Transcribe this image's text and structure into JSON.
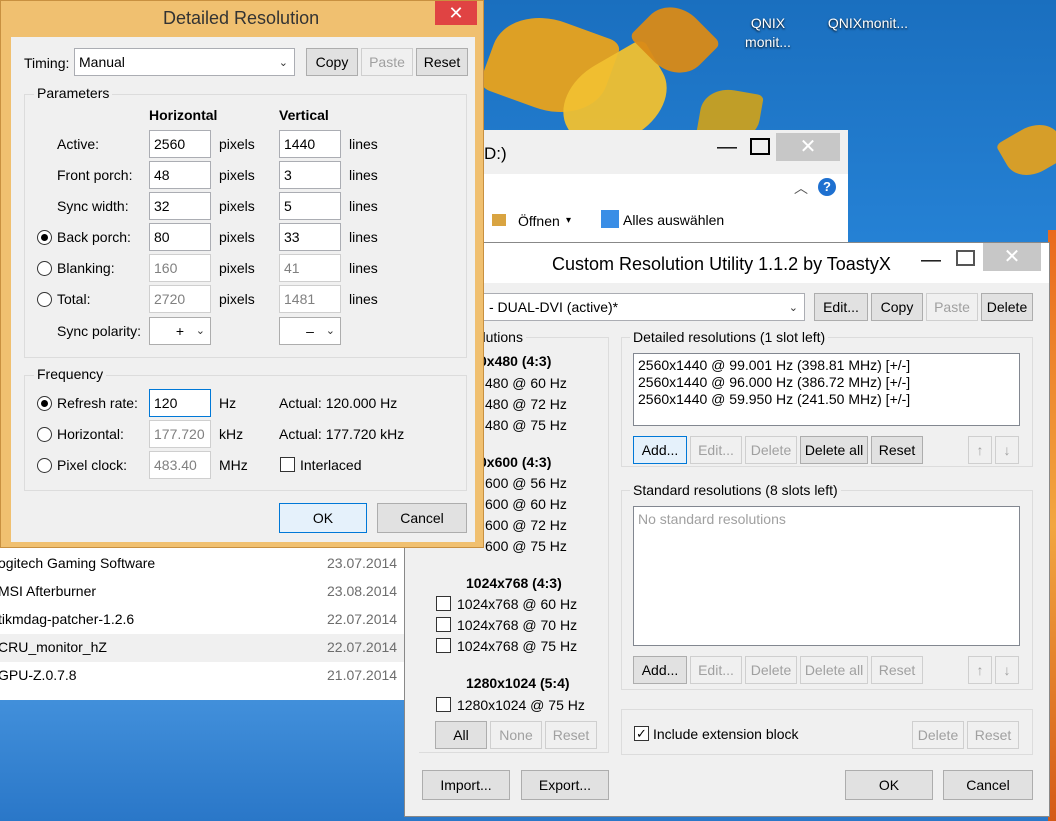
{
  "desktop": {
    "icons": [
      {
        "label": "QNIX\nmonit..."
      },
      {
        "label": "QNIXmonit..."
      }
    ]
  },
  "explorer": {
    "title_fragment": "D:)",
    "ribbon": {
      "open_label": "Öffnen",
      "select_all_label": "Alles auswählen"
    },
    "files": [
      {
        "name": "ogitech Gaming Software",
        "date": "23.07.2014"
      },
      {
        "name": "MSI Afterburner",
        "date": "23.08.2014"
      },
      {
        "name": "tikmdag-patcher-1.2.6",
        "date": "22.07.2014"
      },
      {
        "name": "CRU_monitor_hZ",
        "date": "22.07.2014"
      },
      {
        "name": "GPU-Z.0.7.8",
        "date": "21.07.2014"
      }
    ]
  },
  "cru": {
    "title": "Custom Resolution Utility 1.1.2 by ToastyX",
    "monitor_select": "- DUAL-DVI (active)*",
    "buttons": {
      "edit": "Edit...",
      "copy": "Copy",
      "paste": "Paste",
      "delete": "Delete"
    },
    "established": {
      "title_fragment": "ned resolutions",
      "groups": [
        {
          "header": "0x480 (4:3)",
          "items": [
            "480 @ 60 Hz",
            "480 @ 72 Hz",
            "480 @ 75 Hz"
          ]
        },
        {
          "header": "0x600 (4:3)",
          "items": [
            "600 @ 56 Hz",
            "600 @ 60 Hz",
            "600 @ 72 Hz",
            "600 @ 75 Hz"
          ]
        },
        {
          "header": "1024x768 (4:3)",
          "items": [
            "1024x768 @ 60 Hz",
            "1024x768 @ 70 Hz",
            "1024x768 @ 75 Hz"
          ]
        },
        {
          "header": "1280x1024 (5:4)",
          "items": [
            "1280x1024 @ 75 Hz"
          ]
        }
      ],
      "btn_all": "All",
      "btn_none": "None",
      "btn_reset": "Reset"
    },
    "detailed": {
      "title": "Detailed resolutions (1 slot left)",
      "items": [
        "2560x1440 @ 99.001 Hz (398.81 MHz) [+/-]",
        "2560x1440 @ 96.000 Hz (386.72 MHz) [+/-]",
        "2560x1440 @ 59.950 Hz (241.50 MHz) [+/-]"
      ],
      "btn_add": "Add...",
      "btn_edit": "Edit...",
      "btn_delete": "Delete",
      "btn_delete_all": "Delete all",
      "btn_reset": "Reset"
    },
    "standard": {
      "title": "Standard resolutions (8 slots left)",
      "empty": "No standard resolutions",
      "btn_add": "Add...",
      "btn_edit": "Edit...",
      "btn_delete": "Delete",
      "btn_delete_all": "Delete all",
      "btn_reset": "Reset"
    },
    "extension": {
      "label": "Include extension block",
      "btn_delete": "Delete",
      "btn_reset": "Reset"
    },
    "btn_import": "Import...",
    "btn_export": "Export...",
    "btn_ok": "OK",
    "btn_cancel": "Cancel"
  },
  "detail": {
    "title": "Detailed Resolution",
    "timing_label": "Timing:",
    "timing_value": "Manual",
    "btn_copy": "Copy",
    "btn_paste": "Paste",
    "btn_reset": "Reset",
    "params_title": "Parameters",
    "col_h": "Horizontal",
    "col_v": "Vertical",
    "rows": [
      {
        "label": "Active:",
        "h": "2560",
        "h_unit": "pixels",
        "v": "1440",
        "v_unit": "lines"
      },
      {
        "label": "Front porch:",
        "h": "48",
        "h_unit": "pixels",
        "v": "3",
        "v_unit": "lines"
      },
      {
        "label": "Sync width:",
        "h": "32",
        "h_unit": "pixels",
        "v": "5",
        "v_unit": "lines"
      },
      {
        "label": "Back porch:",
        "h": "80",
        "h_unit": "pixels",
        "v": "33",
        "v_unit": "lines"
      },
      {
        "label": "Blanking:",
        "h": "160",
        "h_unit": "pixels",
        "v": "41",
        "v_unit": "lines"
      },
      {
        "label": "Total:",
        "h": "2720",
        "h_unit": "pixels",
        "v": "1481",
        "v_unit": "lines"
      }
    ],
    "sync_label": "Sync polarity:",
    "sync_h": "+",
    "sync_v": "–",
    "freq_title": "Frequency",
    "refresh_label": "Refresh rate:",
    "refresh_value": "120",
    "refresh_unit": "Hz",
    "refresh_actual": "Actual: 120.000 Hz",
    "hfreq_label": "Horizontal:",
    "hfreq_value": "177.720",
    "hfreq_unit": "kHz",
    "hfreq_actual": "Actual: 177.720 kHz",
    "pclk_label": "Pixel clock:",
    "pclk_value": "483.40",
    "pclk_unit": "MHz",
    "interlaced_label": "Interlaced",
    "btn_ok": "OK",
    "btn_cancel": "Cancel"
  }
}
